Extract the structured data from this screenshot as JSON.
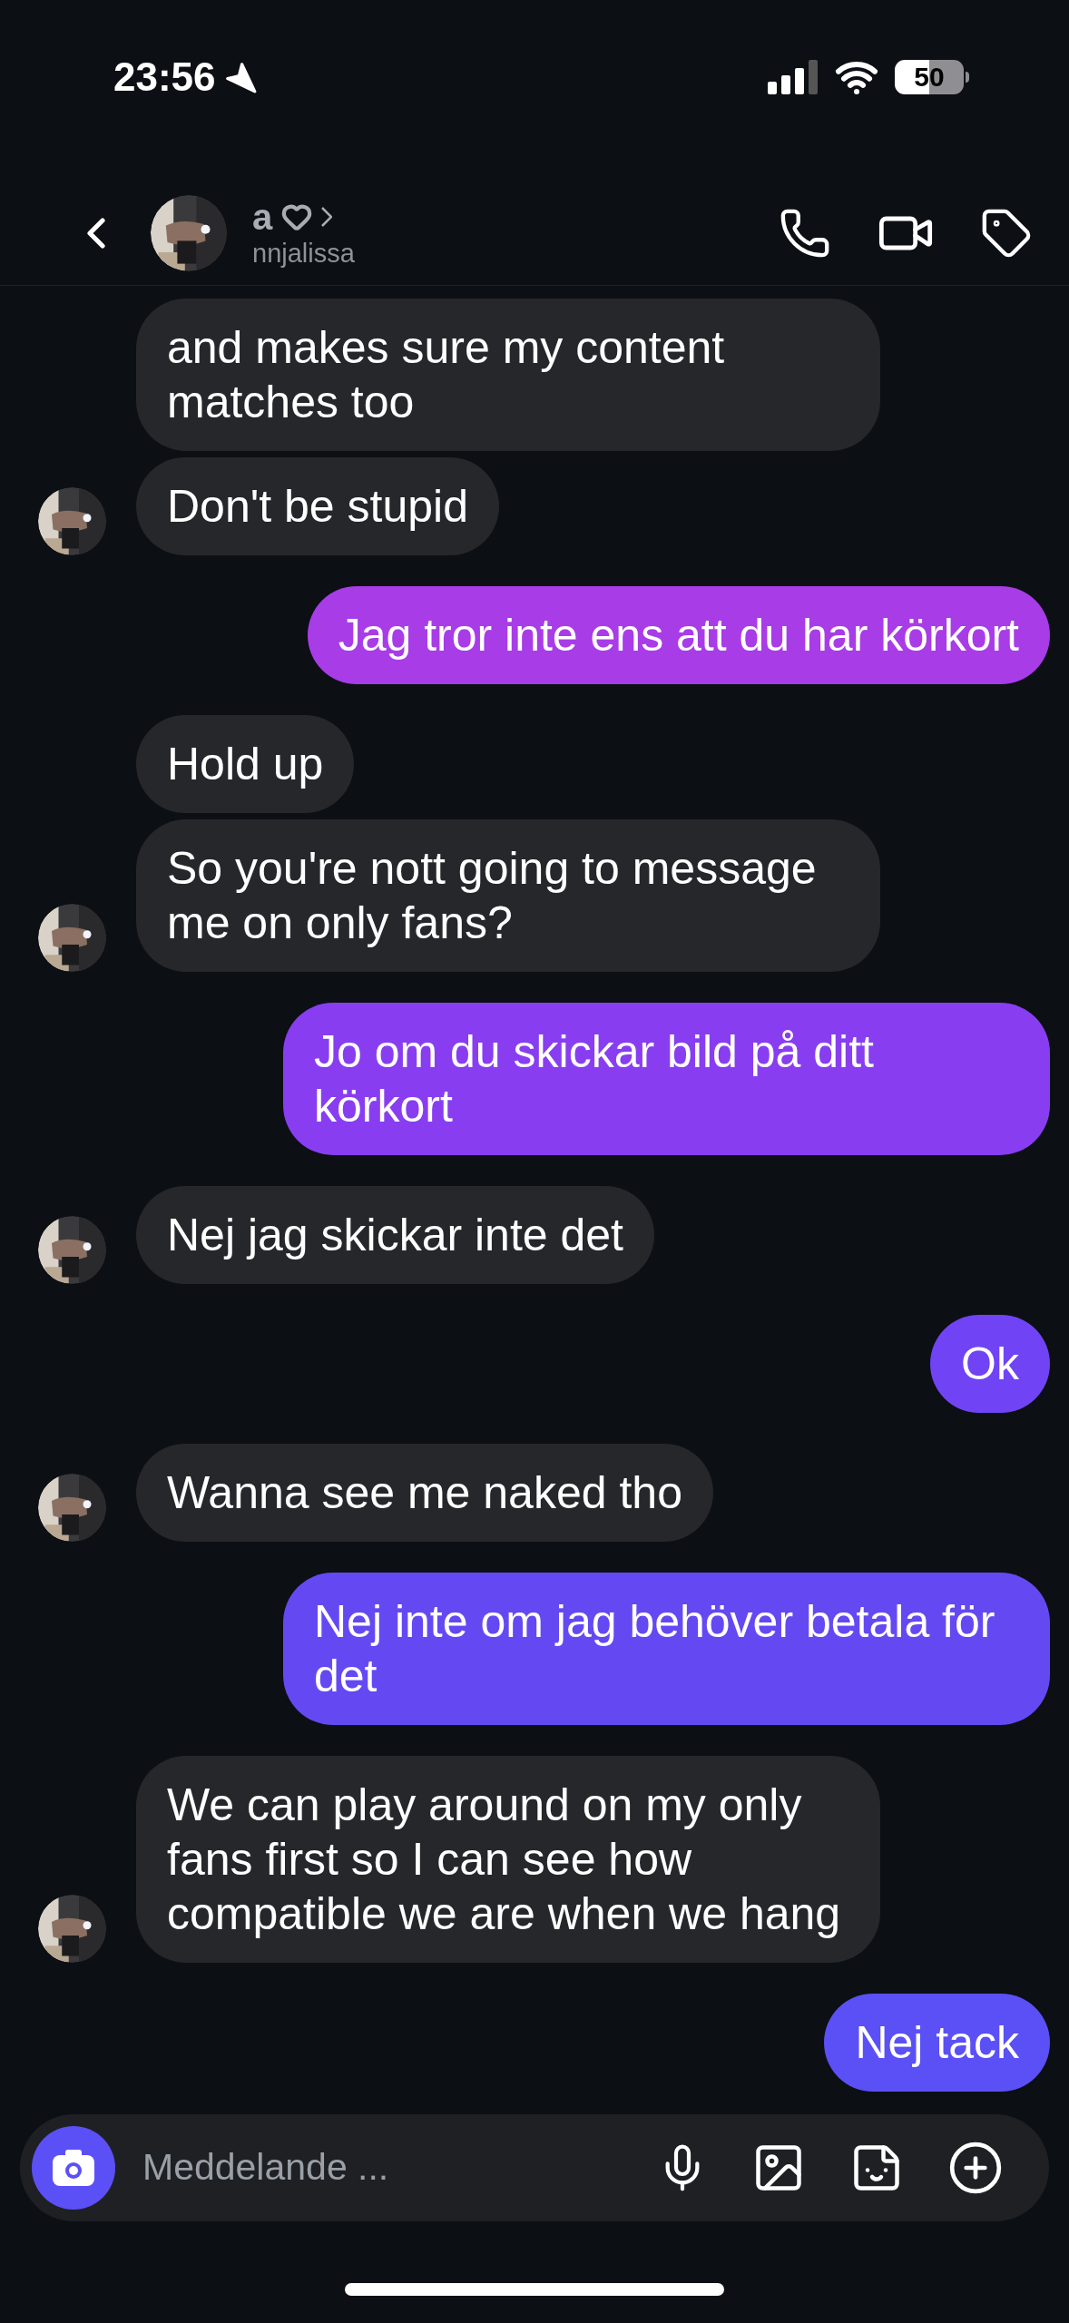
{
  "status_bar": {
    "time": "23:56",
    "battery": "50"
  },
  "header": {
    "name": "a",
    "username": "nnjalissa"
  },
  "messages": [
    {
      "kind": "incoming",
      "text": "and makes sure my content matches too",
      "show_avatar": false
    },
    {
      "kind": "incoming",
      "text": "Don't be stupid",
      "show_avatar": true
    },
    {
      "kind": "outgoing",
      "text": "Jag tror inte ens att du har körkort",
      "color": "#a83ce7"
    },
    {
      "kind": "incoming",
      "text": "Hold up",
      "show_avatar": false
    },
    {
      "kind": "incoming",
      "text": "So you're nott going to message me on only fans?",
      "show_avatar": true
    },
    {
      "kind": "outgoing",
      "text": "Jo om du skickar bild på ditt körkort",
      "color": "#883ef0"
    },
    {
      "kind": "incoming",
      "text": "Nej jag skickar inte det",
      "show_avatar": true
    },
    {
      "kind": "outgoing",
      "text": "Ok",
      "color": "#7044f4"
    },
    {
      "kind": "incoming",
      "text": "Wanna see me naked tho",
      "show_avatar": true
    },
    {
      "kind": "outgoing",
      "text": "Nej inte om jag behöver betala för det",
      "color": "#6449f3"
    },
    {
      "kind": "incoming",
      "text": "We can play around on my only fans first so I can see how compatible we are when we hang",
      "show_avatar": true
    },
    {
      "kind": "outgoing",
      "text": "Nej tack",
      "color": "#5a50f5"
    }
  ],
  "composer": {
    "placeholder": "Meddelande ..."
  }
}
